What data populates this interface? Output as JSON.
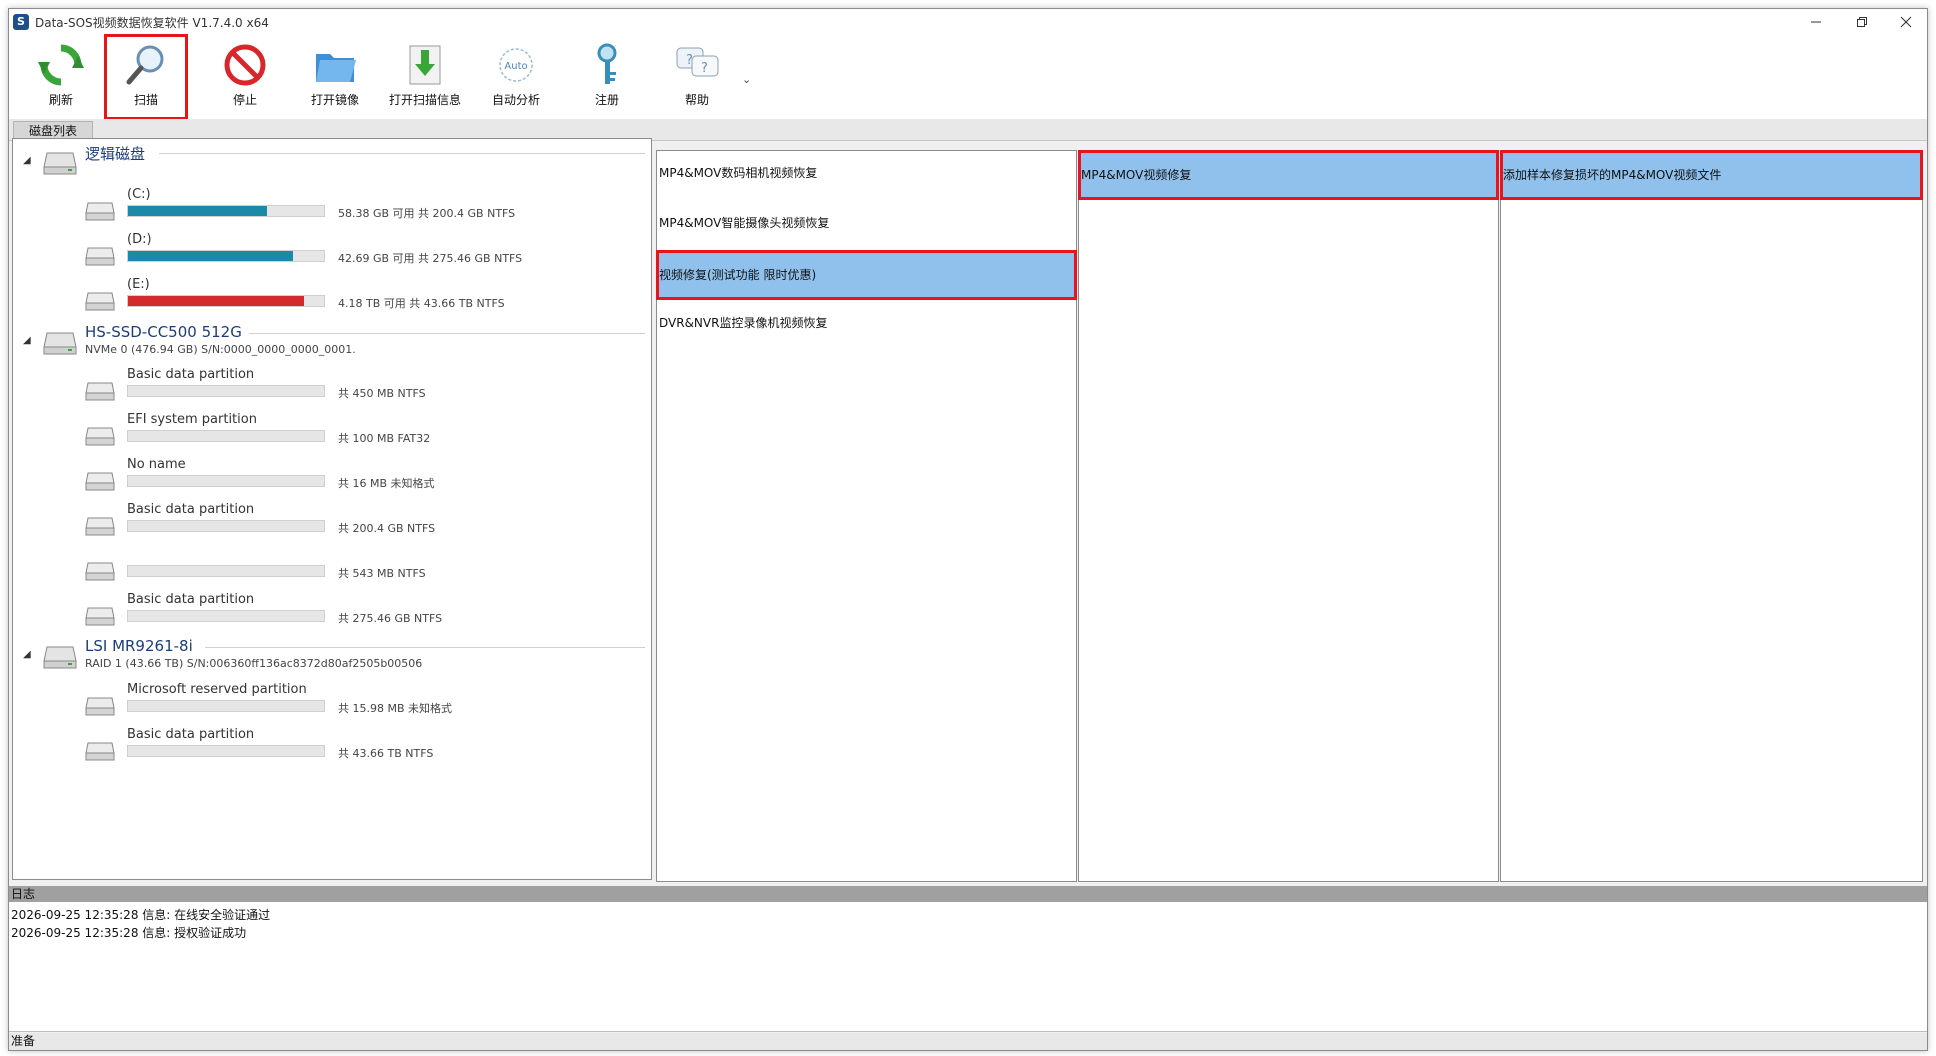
{
  "window": {
    "title": "Data-SOS视频数据恢复软件 V1.7.4.0 x64",
    "app_icon_glyph": "S"
  },
  "toolbar": {
    "refresh": "刷新",
    "scan": "扫描",
    "stop": "停止",
    "open_image": "打开镜像",
    "open_scan_info": "打开扫描信息",
    "auto_analyze": "自动分析",
    "register": "注册",
    "help": "帮助",
    "auto_icon_text": "Auto",
    "more_glyph": "⌄"
  },
  "tabs": {
    "disk_list": "磁盘列表"
  },
  "disks": {
    "logical": {
      "name": "逻辑磁盘",
      "partitions": [
        {
          "name": "(C:)",
          "info": "58.38 GB 可用 共 200.4 GB NTFS",
          "used_fraction": 0.71,
          "color": "#1b8aa8"
        },
        {
          "name": "(D:)",
          "info": "42.69 GB 可用 共 275.46 GB NTFS",
          "used_fraction": 0.84,
          "color": "#1b8aa8"
        },
        {
          "name": "(E:)",
          "info": "4.18 TB 可用 共 43.66 TB NTFS",
          "used_fraction": 0.9,
          "color": "#d32a2e"
        }
      ]
    },
    "ssd": {
      "name": "HS-SSD-CC500 512G",
      "sub": "NVMe 0 (476.94 GB) S/N:0000_0000_0000_0001.",
      "partitions": [
        {
          "name": "Basic data partition",
          "info": "共 450 MB NTFS"
        },
        {
          "name": "EFI system partition",
          "info": "共 100 MB FAT32"
        },
        {
          "name": "No name",
          "info": "共 16 MB 未知格式"
        },
        {
          "name": "Basic data partition",
          "info": "共 200.4 GB NTFS"
        },
        {
          "name": "",
          "info": "共 543 MB NTFS"
        },
        {
          "name": "Basic data partition",
          "info": "共 275.46 GB NTFS"
        }
      ]
    },
    "raid": {
      "name": "LSI MR9261-8i",
      "sub": "RAID 1 (43.66 TB) S/N:006360ff136ac8372d80af2505b00506",
      "partitions": [
        {
          "name": "Microsoft reserved partition",
          "info": "共 15.98 MB 未知格式"
        },
        {
          "name": "Basic data partition",
          "info": "共 43.66 TB NTFS"
        }
      ]
    }
  },
  "recovery": {
    "col1": [
      "MP4&MOV数码相机视频恢复",
      "MP4&MOV智能摄像头视频恢复",
      "视频修复(测试功能 限时优惠)",
      "DVR&NVR监控录像机视频恢复"
    ],
    "col2": [
      "MP4&MOV视频修复"
    ],
    "col3": [
      "添加样本修复损坏的MP4&MOV视频文件"
    ]
  },
  "log": {
    "title": "日志",
    "lines": [
      "2026-09-25 12:35:28 信息: 在线安全验证通过",
      "2026-09-25 12:35:28 信息: 授权验证成功"
    ]
  },
  "status": {
    "text": "准备"
  }
}
